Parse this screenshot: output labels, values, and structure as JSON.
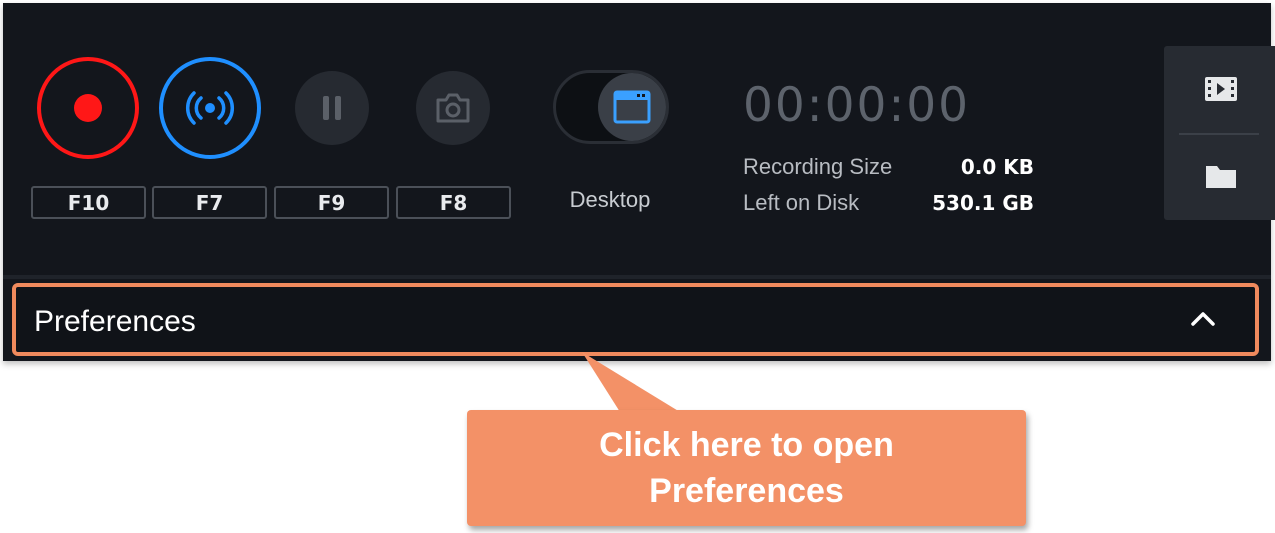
{
  "recorder": {
    "hotkeys": {
      "record": "F10",
      "stream": "F7",
      "pause": "F9",
      "snapshot": "F8"
    },
    "capture_mode": "Desktop",
    "timer": "00:00:00",
    "stats": {
      "recording_size_label": "Recording Size",
      "recording_size_value": "0.0 KB",
      "left_on_disk_label": "Left on Disk",
      "left_on_disk_value": "530.1 GB"
    },
    "side_icons": [
      "film-icon",
      "folder-icon"
    ]
  },
  "preferences": {
    "label": "Preferences",
    "chevron": "chevron-up-icon"
  },
  "callout": {
    "line1": "Click here to open",
    "line2": "Preferences"
  },
  "colors": {
    "record": "#ff1717",
    "stream": "#1f8fff",
    "panel_bg": "#13161c",
    "callout": "#f39167",
    "highlight_border": "#f08a5d",
    "window_icon": "#3aa0ff"
  }
}
